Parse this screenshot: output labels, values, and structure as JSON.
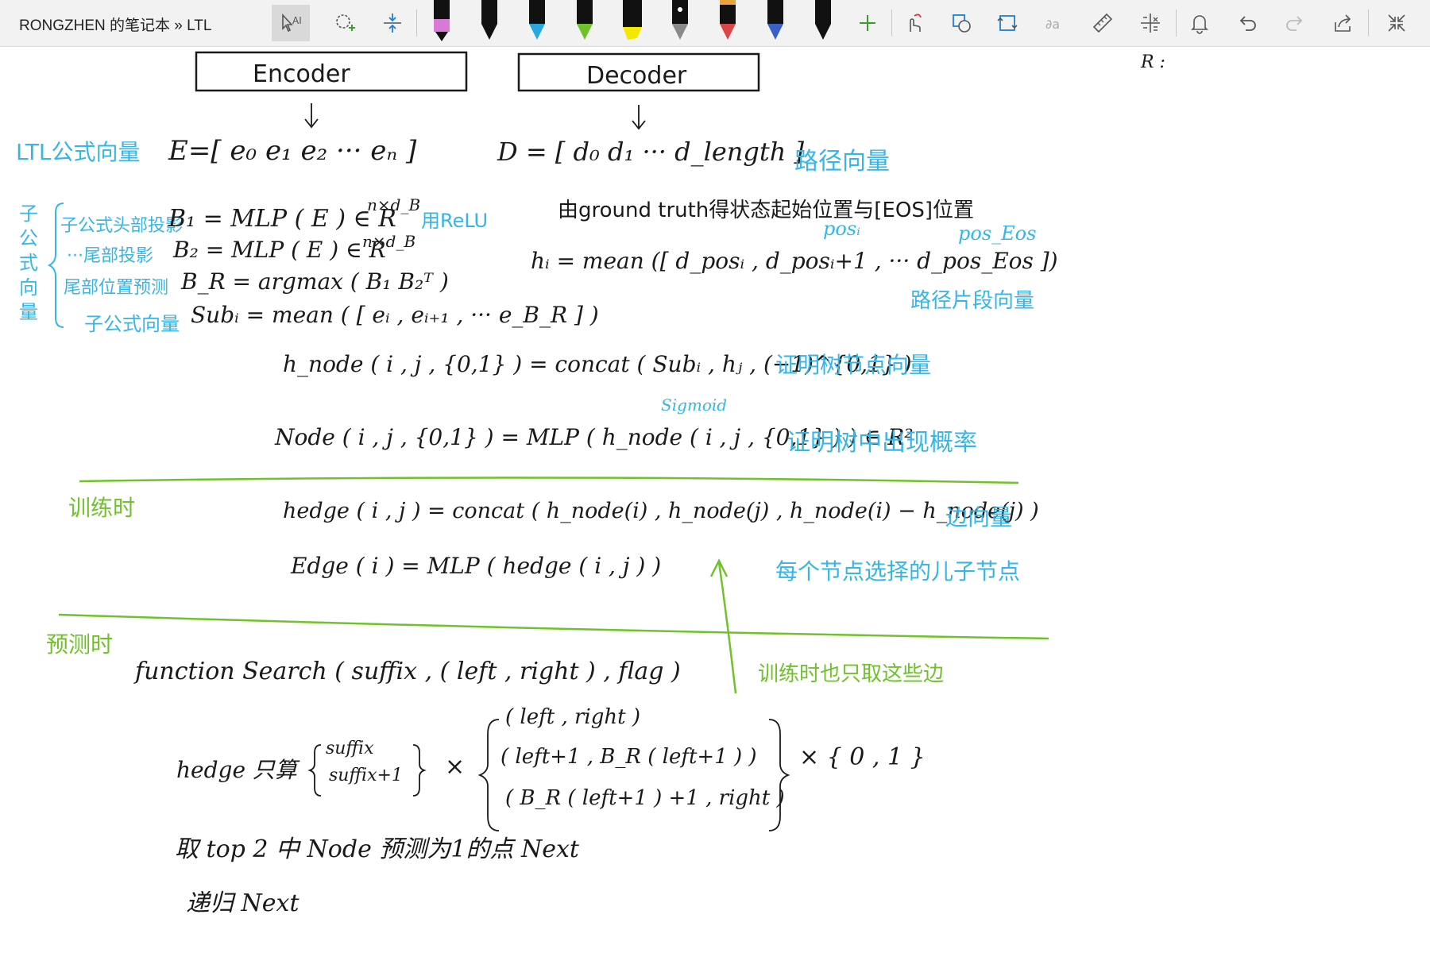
{
  "window": {
    "title": "RONGZHEN 的笔记本 » LTL"
  },
  "colors": {
    "ink_black": "#1a1a1a",
    "ink_blue": "#35b5e8",
    "ink_green": "#6fc22a",
    "toolbar_bg": "#f2f2f2"
  },
  "toolbar": {
    "tools": [
      "text-select-icon",
      "lasso-select-icon",
      "insert-space-icon"
    ],
    "pens": [
      {
        "name": "pen-black",
        "color": "#111111"
      },
      {
        "name": "pen-pink",
        "color": "#d879d6"
      },
      {
        "name": "pen-black-2",
        "color": "#111111"
      },
      {
        "name": "pen-blue",
        "color": "#29a8e0"
      },
      {
        "name": "pen-green",
        "color": "#6fc22a"
      },
      {
        "name": "highlighter-yellow",
        "color": "#f5e800"
      },
      {
        "name": "pen-galaxy",
        "color": "#8a8a8a"
      },
      {
        "name": "pen-rainbow",
        "color": "#d44"
      },
      {
        "name": "pen-cosmic",
        "color": "#3a60c8"
      },
      {
        "name": "pen-black-3",
        "color": "#111111"
      }
    ],
    "actions": [
      "add-pen-icon",
      "touch-draw-icon",
      "ink-to-shape-icon",
      "ink-to-text-icon",
      "ink-to-math-icon",
      "ruler-icon",
      "math-icon",
      "notification-icon",
      "undo-icon",
      "redo-icon",
      "share-icon",
      "fullscreen-icon"
    ]
  },
  "note": {
    "encoder_box": "Encoder",
    "decoder_box": "Decoder",
    "r_label": "R :",
    "ltl_vec_label": "LTL公式向量",
    "E_eq": "E=[ e₀  e₁  e₂ ···  eₙ ]",
    "D_eq": "D = [ d₀  d₁  ···    d_length ]",
    "path_vec_label": "路径向量",
    "groundtruth_line": "由ground truth得状态起始位置与[EOS]位置",
    "pos_i": "posᵢ",
    "pos_eos": "pos_Eos",
    "h_i_eq": "hᵢ = mean ([ d_posᵢ , d_posᵢ+1 , ··· d_pos_Eos ])",
    "path_seg_label": "路径片段向量",
    "sub_vec_side": [
      "子",
      "公",
      "式",
      "向",
      "量"
    ],
    "head_proj_label": "子公式头部投影",
    "tail_proj_label": "···尾部投影",
    "tail_pred_label": "尾部位置预测",
    "sub_vec_label": "子公式向量",
    "B1_eq": "B₁ = MLP ( E ) ∈ R",
    "B2_eq": "B₂ = MLP ( E ) ∈ R",
    "BR_eq": "B_R = argmax ( B₁ B₂ᵀ )",
    "sub_eq": "Subᵢ = mean ( [ eᵢ , eᵢ₊₁ , ··· e_B_R ] )",
    "dims": "n×d_B",
    "relu": "用ReLU",
    "hnode_eq": "h_node ( i , j , {0,1} ) = concat ( Subᵢ , hⱼ , (−1)^{0,1} )",
    "hnode_label": "证明树节点向量",
    "sigmoid": "Sigmoid",
    "node_eq": "Node ( i , j , {0,1} ) = MLP ( h_node ( i , j , {0,1} ) )  ∈ R²",
    "node_label": "证明树中出现概率",
    "train_label": "训练时",
    "hedge_eq": "hedge ( i , j ) = concat ( h_node(i) , h_node(j) , h_node(i) − h_node(j) )",
    "edge_vec_label": "边向量",
    "edge_eq": "Edge ( i ) = MLP ( hedge ( i , j ) )",
    "child_label": "每个节点选择的儿子节点",
    "only_edges_label": "训练时也只取这些边",
    "predict_label": "预测时",
    "func_line": "function   Search ( suffix , ( left , right ) , flag )",
    "hedge_only": "hedge 只算",
    "set1": [
      "suffix",
      "suffix+1"
    ],
    "times1": "×",
    "set2": [
      "( left , right )",
      "( left+1 , B_R ( left+1 ) )",
      "( B_R ( left+1 ) +1 , right )"
    ],
    "times2": "× { 0 , 1 }",
    "take_top": "取 top 2 中 Node 预测为1的点 Next",
    "recurse": "递归 Next"
  }
}
